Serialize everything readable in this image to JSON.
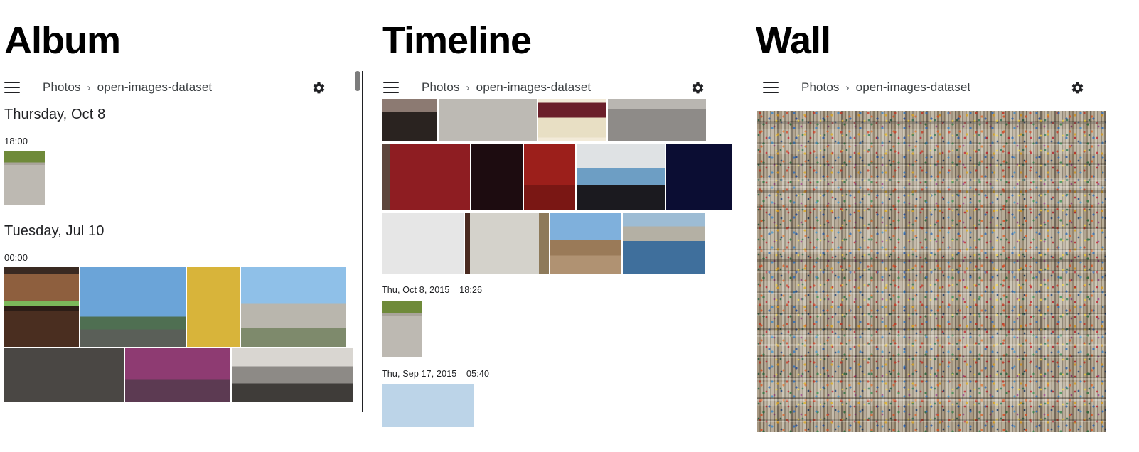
{
  "panels": [
    {
      "id": "album",
      "title": "Album",
      "appbar": {
        "menu_icon": "hamburger-icon",
        "breadcrumb": [
          "Photos",
          "open-images-dataset"
        ],
        "separator": "›",
        "settings_icon": "gear-icon"
      },
      "groups": [
        {
          "date": "Thursday, Oct 8",
          "time": "18:00"
        },
        {
          "date": "Tuesday, Jul 10",
          "time": "00:00"
        }
      ]
    },
    {
      "id": "timeline",
      "title": "Timeline",
      "appbar": {
        "menu_icon": "hamburger-icon",
        "breadcrumb": [
          "Photos",
          "open-images-dataset"
        ],
        "separator": "›",
        "settings_icon": "gear-icon"
      },
      "entries": [
        {
          "date": "Thu, Oct 8, 2015",
          "time": "18:26"
        },
        {
          "date": "Thu, Sep 17, 2015",
          "time": "05:40"
        }
      ]
    },
    {
      "id": "wall",
      "title": "Wall",
      "appbar": {
        "menu_icon": "hamburger-icon",
        "breadcrumb": [
          "Photos",
          "open-images-dataset"
        ],
        "separator": "›",
        "settings_icon": "gear-icon"
      }
    }
  ],
  "colors": {
    "page_background": "#ffffff",
    "title_text": "#000000",
    "breadcrumb_text": "#3c4043",
    "icon": "#202124",
    "divider": "#202124",
    "scrollbar_thumb": "#7c7c7c",
    "mosaic_base": "#a79c8c"
  }
}
